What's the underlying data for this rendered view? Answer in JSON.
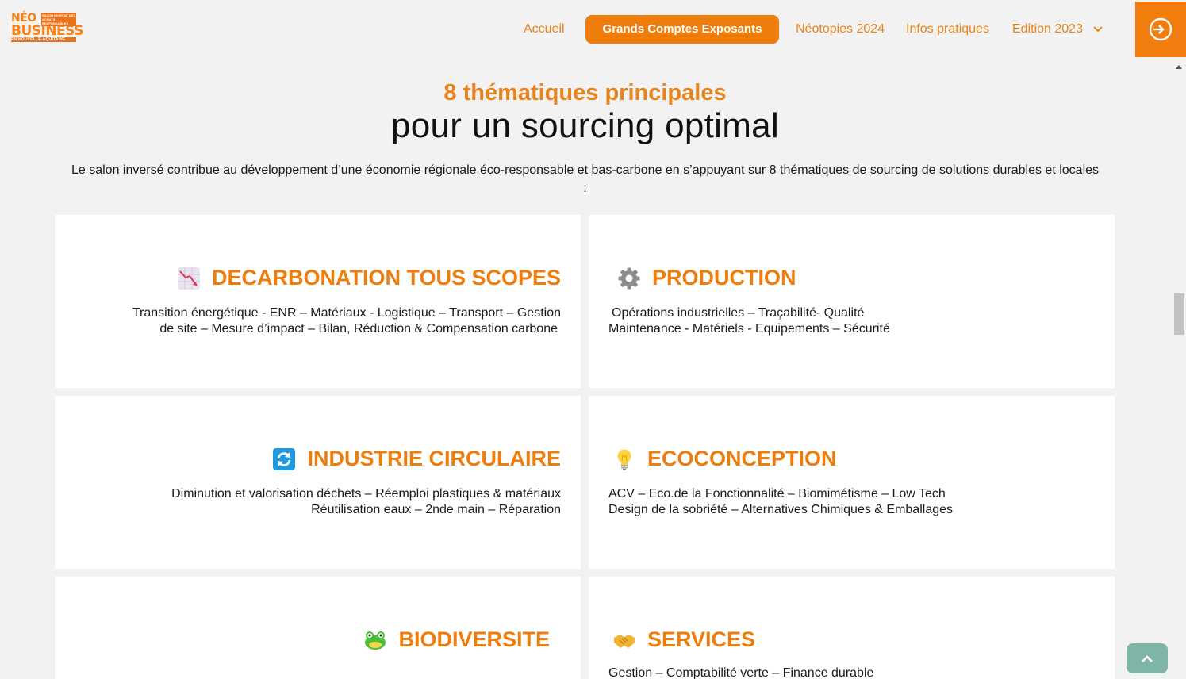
{
  "header": {
    "logo": {
      "line1": "NÉO",
      "line2": "BUSINESS",
      "tagline": "EN NOUVELLE-AQUITAINE",
      "tag": "SALON INVERSÉ DES ACHATS RESPONSABLES"
    },
    "nav": {
      "accueil": "Accueil",
      "grands_comptes": "Grands Comptes Exposants",
      "neotopies": "Néotopies 2024",
      "infos": "Infos pratiques",
      "edition": "Edition 2023"
    },
    "login_icon": "login-arrow-icon"
  },
  "section": {
    "title_orange": "8 thématiques principales",
    "title_black": "pour un sourcing optimal",
    "intro": "Le salon inversé contribue au développement d’une économie régionale éco-responsable et bas-carbone en s’appuyant sur 8 thématiques de sourcing de solutions durables et locales :"
  },
  "cards": [
    {
      "title": "DECARBONATION TOUS SCOPES",
      "icon": "chart-decreasing-icon",
      "lines": [
        "Transition énergétique - ENR – Matériaux - Logistique – Transport – Gestion",
        "de site – Mesure d’impact – Bilan, Réduction & Compensation carbone"
      ]
    },
    {
      "title": "PRODUCTION",
      "icon": "gear-icon",
      "lines": [
        "Opérations industrielles – Traçabilité- Qualité",
        "Maintenance - Matériels - Equipements – Sécurité"
      ]
    },
    {
      "title": "INDUSTRIE CIRCULAIRE",
      "icon": "recycle-arrows-icon",
      "lines": [
        "Diminution et valorisation déchets – Réemploi plastiques & matériaux",
        "Réutilisation eaux – 2nde main – Réparation"
      ]
    },
    {
      "title": "ECOCONCEPTION",
      "icon": "light-bulb-icon",
      "lines": [
        "ACV – Eco.de la Fonctionnalité – Biomimétisme – Low Tech",
        "Design de la sobriété – Alternatives Chimiques & Emballages"
      ]
    },
    {
      "title": "BIODIVERSITE",
      "icon": "frog-icon",
      "lines": []
    },
    {
      "title": "SERVICES",
      "icon": "handshake-icon",
      "lines": [
        "Gestion – Comptabilité verte – Finance durable"
      ]
    }
  ],
  "colors": {
    "accent": "#ef7d0b",
    "nav_text": "#e8841b",
    "to_top": "#7fb5a8"
  }
}
